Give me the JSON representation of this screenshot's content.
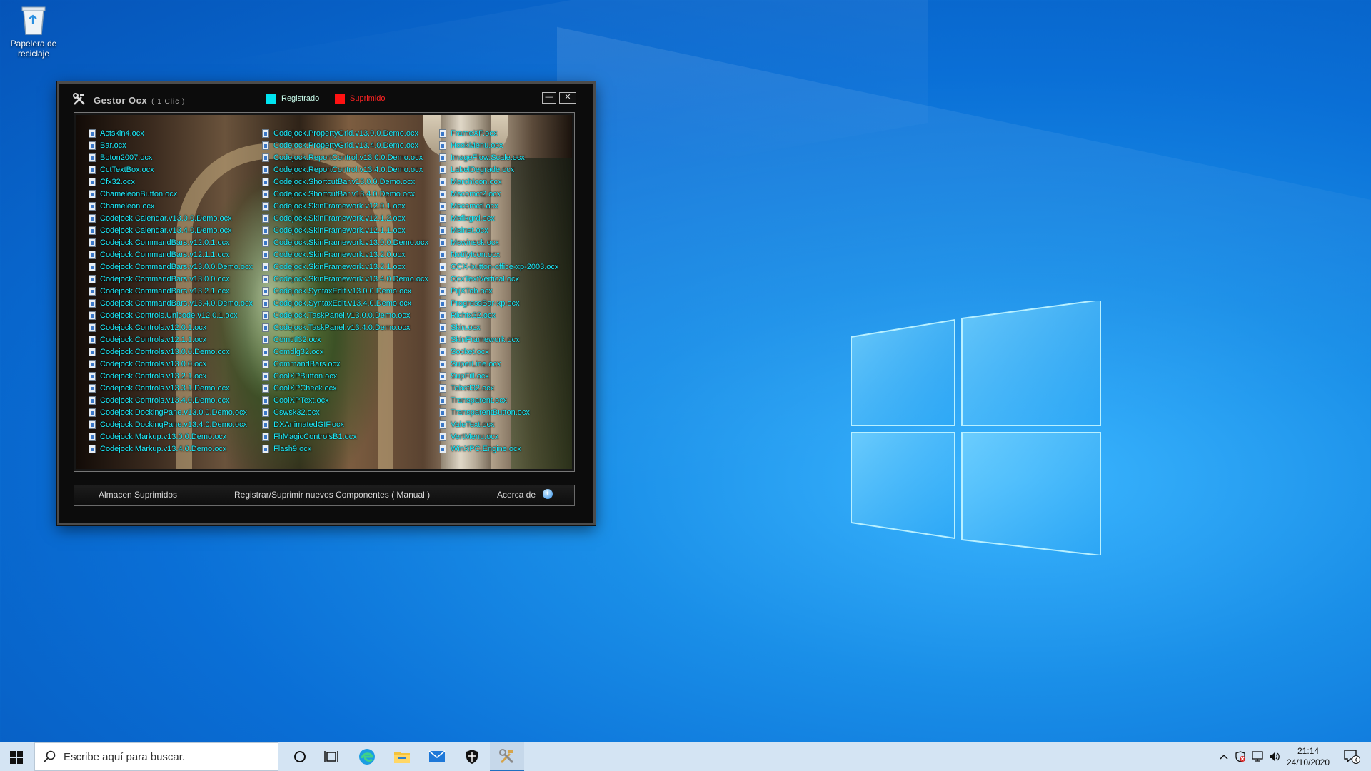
{
  "desktop": {
    "recycle_bin_label": "Papelera de reciclaje"
  },
  "app": {
    "title": "Gestor Ocx",
    "title_hint": "( 1 Clic )",
    "legend_registered": "Registrado",
    "legend_removed": "Suprimido",
    "colors": {
      "registered": "#00e4f0",
      "removed": "#ff1212"
    },
    "minimize_label": "—",
    "close_label": "✕",
    "files_col1": [
      "Actskin4.ocx",
      "Bar.ocx",
      "Boton2007.ocx",
      "CctTextBox.ocx",
      "Cfx32.ocx",
      "ChameleonButton.ocx",
      "Chameleon.ocx",
      "Codejock.Calendar.v13.0.0.Demo.ocx",
      "Codejock.Calendar.v13.4.0.Demo.ocx",
      "Codejock.CommandBars.v12.0.1.ocx",
      "Codejock.CommandBars.v12.1.1.ocx",
      "Codejock.CommandBars.v13.0.0.Demo.ocx",
      "Codejock.CommandBars.v13.0.0.ocx",
      "Codejock.CommandBars.v13.2.1.ocx",
      "Codejock.CommandBars.v13.4.0.Demo.ocx",
      "Codejock.Controls.Unicode.v12.0.1.ocx",
      "Codejock.Controls.v12.0.1.ocx",
      "Codejock.Controls.v12.1.1.ocx",
      "Codejock.Controls.v13.0.0.Demo.ocx",
      "Codejock.Controls.v13.0.0.ocx",
      "Codejock.Controls.v13.2.1.ocx",
      "Codejock.Controls.v13.3.1.Demo.ocx",
      "Codejock.Controls.v13.4.0.Demo.ocx",
      "Codejock.DockingPane.v13.0.0.Demo.ocx",
      "Codejock.DockingPane.v13.4.0.Demo.ocx",
      "Codejock.Markup.v13.0.0.Demo.ocx",
      "Codejock.Markup.v13.4.0.Demo.ocx"
    ],
    "files_col2": [
      "Codejock.PropertyGrid.v13.0.0.Demo.ocx",
      "Codejock.PropertyGrid.v13.4.0.Demo.ocx",
      "Codejock.ReportControl.v13.0.0.Demo.ocx",
      "Codejock.ReportControl.v13.4.0.Demo.ocx",
      "Codejock.ShortcutBar.v13.0.0.Demo.ocx",
      "Codejock.ShortcutBar.v13.4.0.Demo.ocx",
      "Codejock.SkinFramework.v12.0.1.ocx",
      "Codejock.SkinFramework.v12.1.2.ocx",
      "Codejock.SkinFramework.v12.1.1.ocx",
      "Codejock.SkinFramework.v13.0.0.Demo.ocx",
      "Codejock.SkinFramework.v13.2.0.ocx",
      "Codejock.SkinFramework.v13.2.1.ocx",
      "Codejock.SkinFramework.v13.4.0.Demo.ocx",
      "Codejock.SyntaxEdit.v13.0.0.Demo.ocx",
      "Codejock.SyntaxEdit.v13.4.0.Demo.ocx",
      "Codejock.TaskPanel.v13.0.0.Demo.ocx",
      "Codejock.TaskPanel.v13.4.0.Demo.ocx",
      "Comctl32.ocx",
      "Comdlg32.ocx",
      "CommandBars.ocx",
      "CoolXPButton.ocx",
      "CoolXPCheck.ocx",
      "CoolXPText.ocx",
      "Cswsk32.ocx",
      "DXAnimatedGIF.ocx",
      "FhMagicControlsB1.ocx",
      "Flash9.ocx"
    ],
    "files_col3": [
      "FrameXP.ocx",
      "HookMenu.ocx",
      "ImageFlow.Scale.ocx",
      "LabelDegrade.ocx",
      "MarchIcon.ocx",
      "Mscomct2.ocx",
      "Mscomctl.ocx",
      "Msflxgrd.ocx",
      "Msinet.ocx",
      "Mswinsck.ocx",
      "NotifyIcon.ocx",
      "OCX-button-office-xp-2003.ocx",
      "OcxTextVertical.ocx",
      "PrjXTab.ocx",
      "ProgressBar-xp.ocx",
      "Richtx32.ocx",
      "Skin.ocx",
      "SkinFramework.ocx",
      "Socket.ocx",
      "SuperLine.ocx",
      "SupFill.ocx",
      "Tabctl32.ocx",
      "Transparent.ocx",
      "TransparentButton.ocx",
      "ValeText.ocx",
      "VertMenu.ocx",
      "WinXPC.Engine.ocx"
    ],
    "bottom": {
      "store_label": "Almacen Suprimidos",
      "register_label": "Registrar/Suprimir nuevos Componentes   ( Manual )",
      "about_label": "Acerca de",
      "about_icon": "info-icon"
    }
  },
  "taskbar": {
    "search_placeholder": "Escribe aquí para buscar.",
    "icons": [
      "start-icon",
      "search-icon",
      "cortana-icon",
      "task-view-icon",
      "edge-icon",
      "file-explorer-icon",
      "mail-icon",
      "security-icon",
      "ocx-manager-icon"
    ],
    "time": "21:14",
    "date": "24/10/2020",
    "notification_count": "4"
  }
}
